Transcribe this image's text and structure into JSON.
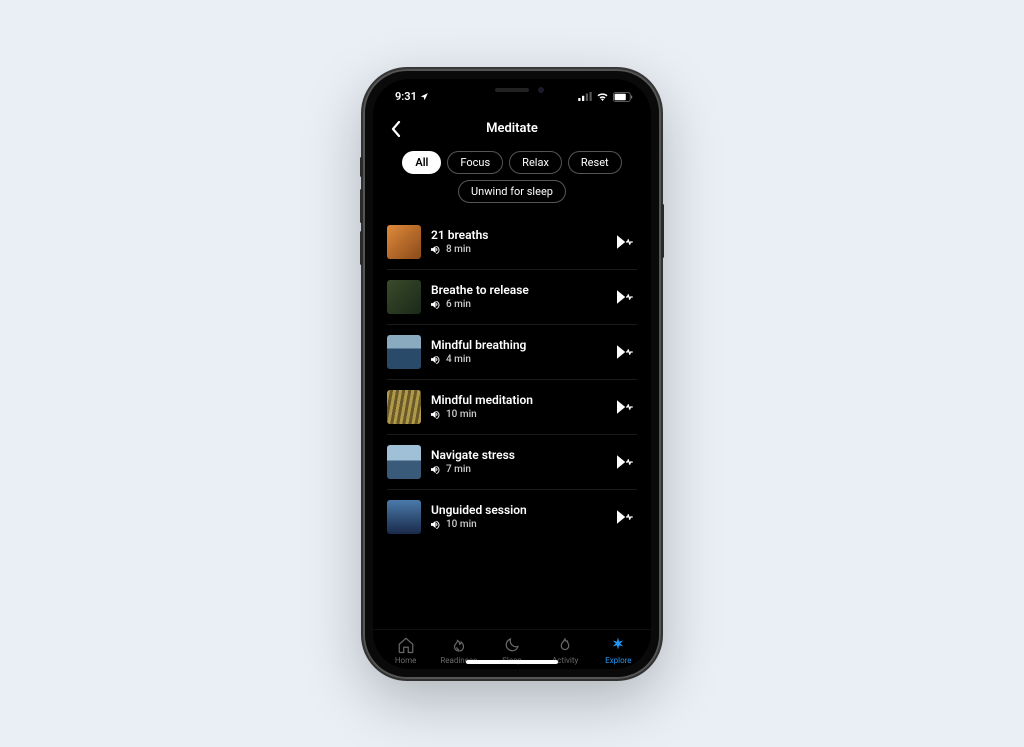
{
  "status": {
    "time": "9:31"
  },
  "header": {
    "title": "Meditate"
  },
  "filters": [
    {
      "label": "All",
      "active": true
    },
    {
      "label": "Focus",
      "active": false
    },
    {
      "label": "Relax",
      "active": false
    },
    {
      "label": "Reset",
      "active": false
    },
    {
      "label": "Unwind for sleep",
      "active": false
    }
  ],
  "sessions": [
    {
      "title": "21 breaths",
      "duration": "8 min",
      "thumb_color": "#c56a2b"
    },
    {
      "title": "Breathe to release",
      "duration": "6 min",
      "thumb_color": "#2d3a2a"
    },
    {
      "title": "Mindful breathing",
      "duration": "4 min",
      "thumb_color": "#3a5a7a"
    },
    {
      "title": "Mindful meditation",
      "duration": "10 min",
      "thumb_color": "#8a7a3a"
    },
    {
      "title": "Navigate stress",
      "duration": "7 min",
      "thumb_color": "#4a6a8a"
    },
    {
      "title": "Unguided session",
      "duration": "10 min",
      "thumb_color": "#2a4a6a"
    }
  ],
  "tabs": [
    {
      "label": "Home"
    },
    {
      "label": "Readiness"
    },
    {
      "label": "Sleep"
    },
    {
      "label": "Activity"
    },
    {
      "label": "Explore"
    }
  ],
  "active_tab": "Explore",
  "accent_color": "#2196F3"
}
